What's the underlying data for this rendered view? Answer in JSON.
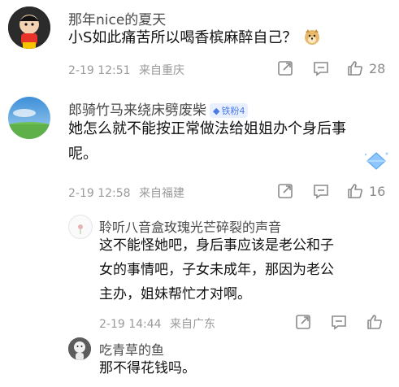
{
  "comments": [
    {
      "username": "那年nice的夏天",
      "text": "小S如此痛苦所以喝香槟麻醉自己？",
      "time": "2-19 12:51",
      "location": "来自重庆",
      "likes": "28",
      "emoji_icon": "doge-emoji-icon"
    },
    {
      "username": "郎骑竹马来绕床劈废柴",
      "badge": "铁粉4",
      "text_line1": "她怎么就不能按正常做法给姐姐办个身后事",
      "text_line2": "呢。",
      "time": "2-19 12:58",
      "location": "来自福建",
      "likes": "16"
    }
  ],
  "replies": [
    {
      "username": "聆听八音盒玫瑰光芒碎裂的声音",
      "text_line1": "这不能怪她吧，身后事应该是老公和子",
      "text_line2": "女的事情吧，子女未成年，那因为老公",
      "text_line3": "主办，姐妹帮忙才对啊。",
      "time": "2-19 14:44",
      "location": "来自广东"
    },
    {
      "username": "吃青草的鱼",
      "text": "那不得花钱吗。"
    }
  ],
  "colors": {
    "accent": "#4a78e6",
    "meta": "#9a9a9a"
  }
}
